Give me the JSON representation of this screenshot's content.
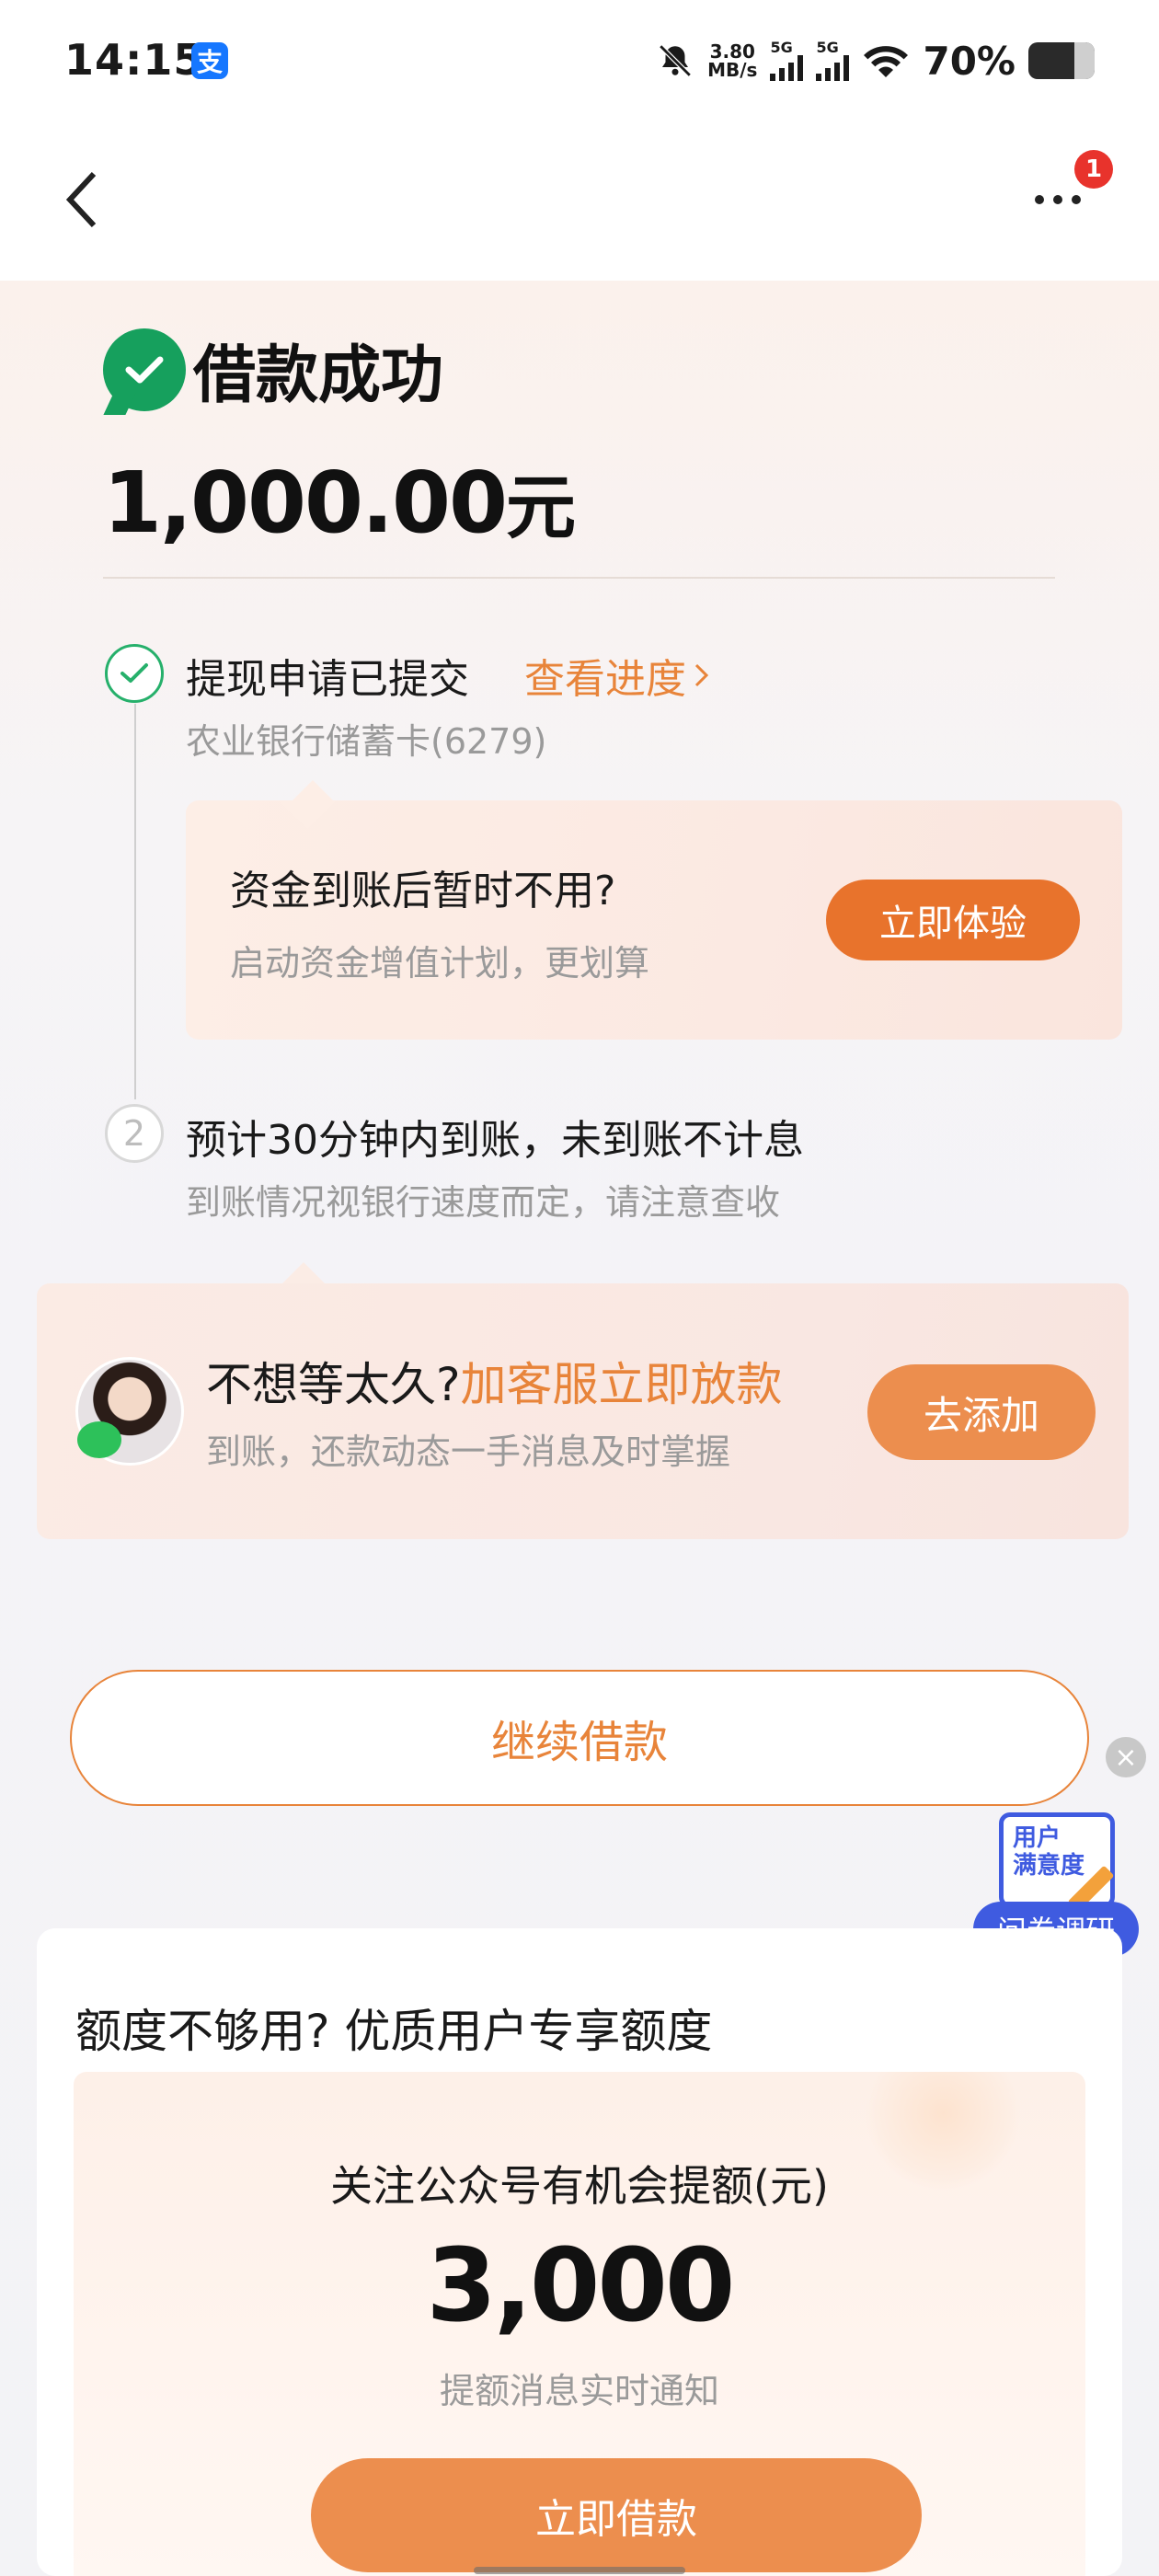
{
  "status_bar": {
    "time": "14:15",
    "app_badge": "支",
    "net_speed_value": "3.80",
    "net_speed_unit": "MB/s",
    "signal_1": "5G",
    "signal_2": "5G",
    "battery": "70%"
  },
  "header": {
    "back_icon": "chevron-left-icon",
    "more_icon": "more-dots-icon",
    "badge_count": "1"
  },
  "result": {
    "title": "借款成功",
    "amount": "1,000.00",
    "amount_unit": "元"
  },
  "steps": [
    {
      "title": "提现申请已提交",
      "link": "查看进度",
      "subtitle": "农业银行储蓄卡(6279)"
    },
    {
      "index": "2",
      "title": "预计30分钟内到账，未到账不计息",
      "subtitle": "到账情况视银行速度而定，请注意查收"
    }
  ],
  "invest_card": {
    "title": "资金到账后暂时不用?",
    "subtitle": "启动资金增值计划，更划算",
    "button": "立即体验"
  },
  "service_card": {
    "title_prefix": "不想等太久?",
    "title_accent": "加客服立即放款",
    "subtitle": "到账，还款动态一手消息及时掌握",
    "button": "去添加"
  },
  "continue_button": "继续借款",
  "survey": {
    "card_line1": "用户",
    "card_line2": "满意度",
    "button": "问卷调研",
    "close": "×"
  },
  "limit_card": {
    "title": "额度不够用? 优质用户专享额度",
    "label": "关注公众号有机会提额(元)",
    "value": "3,000",
    "note": "提额消息实时通知",
    "button": "立即借款"
  },
  "colors": {
    "accent": "#e8843a",
    "success": "#16a05d",
    "survey_blue": "#3f5be0",
    "badge_red": "#e8332c"
  }
}
